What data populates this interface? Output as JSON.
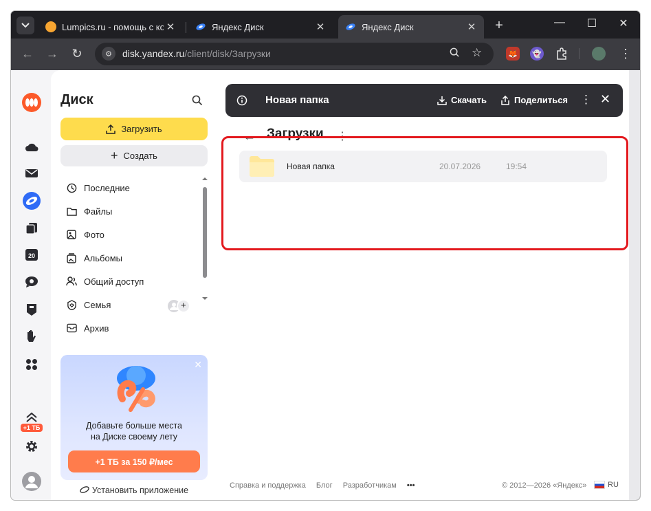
{
  "browser": {
    "tabs": [
      {
        "title": "Lumpics.ru - помощь с ком",
        "favicon_color": "#f7a531"
      },
      {
        "title": "Яндекс Диск",
        "favicon_color": "#3b82f6"
      },
      {
        "title": "Яндекс Диск",
        "favicon_color": "#3b82f6"
      }
    ],
    "url_host": "disk.yandex.ru",
    "url_path": "/client/disk/Загрузки"
  },
  "sidebar": {
    "title": "Диск",
    "upload_label": "Загрузить",
    "create_label": "Создать",
    "items": [
      {
        "label": "Последние",
        "icon": "clock-icon"
      },
      {
        "label": "Файлы",
        "icon": "folder-icon"
      },
      {
        "label": "Фото",
        "icon": "photo-icon"
      },
      {
        "label": "Альбомы",
        "icon": "album-icon"
      },
      {
        "label": "Общий доступ",
        "icon": "people-icon"
      },
      {
        "label": "Семья",
        "icon": "family-icon"
      },
      {
        "label": "Архив",
        "icon": "archive-icon"
      }
    ],
    "family_add": "+",
    "promo": {
      "text_line1": "Добавьте больше места",
      "text_line2": "на Диске своему лету",
      "button": "+1 ТБ за 150 ₽/мес"
    },
    "install_label": "Установить приложение"
  },
  "rail": {
    "badge_calendar": "20",
    "badge_tb": "+1 ТБ"
  },
  "selection_bar": {
    "name": "Новая папка",
    "download_label": "Скачать",
    "share_label": "Поделиться"
  },
  "folder": {
    "title": "Загрузки",
    "files": [
      {
        "name": "Новая папка",
        "date": "20.07.2026",
        "time": "19:54"
      }
    ]
  },
  "footer": {
    "links": [
      "Справка и поддержка",
      "Блог",
      "Разработчикам"
    ],
    "more": "•••",
    "copyright": "© 2012—2026 «Яндекс»",
    "lang": "RU"
  },
  "colors": {
    "accent_yellow": "#fedc4d",
    "promo_orange": "#ff7c4c",
    "highlight_red": "#e3191e"
  }
}
